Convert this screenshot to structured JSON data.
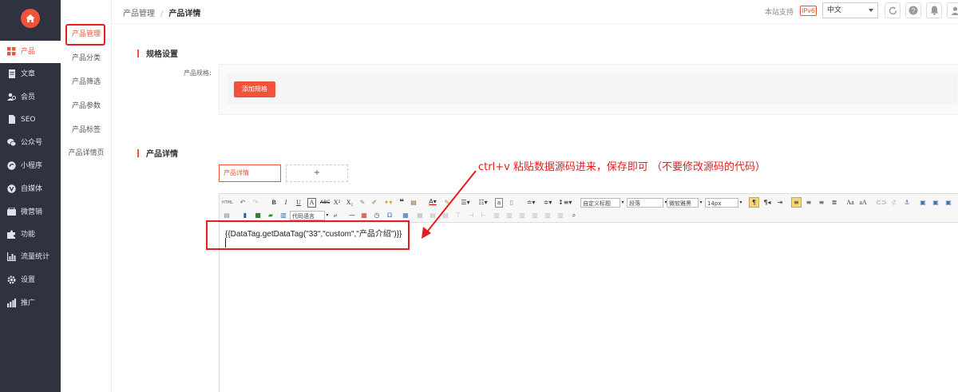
{
  "sidebar": {
    "items": [
      {
        "label": "产品",
        "icon": "grid-icon",
        "active": true
      },
      {
        "label": "文章",
        "icon": "document-icon"
      },
      {
        "label": "会员",
        "icon": "users-icon"
      },
      {
        "label": "SEO",
        "icon": "file-icon"
      },
      {
        "label": "公众号",
        "icon": "wechat-icon"
      },
      {
        "label": "小程序",
        "icon": "miniprogram-icon"
      },
      {
        "label": "自媒体",
        "icon": "media-icon"
      },
      {
        "label": "微营销",
        "icon": "marketing-icon"
      },
      {
        "label": "功能",
        "icon": "puzzle-icon"
      },
      {
        "label": "流量统计",
        "icon": "chart-icon"
      },
      {
        "label": "设置",
        "icon": "gear-icon"
      },
      {
        "label": "推广",
        "icon": "promote-icon"
      }
    ]
  },
  "subnav": {
    "items": [
      {
        "label": "产品管理",
        "active": true
      },
      {
        "label": "产品分类"
      },
      {
        "label": "产品筛选"
      },
      {
        "label": "产品参数"
      },
      {
        "label": "产品标签"
      },
      {
        "label": "产品详情页"
      }
    ]
  },
  "topbar": {
    "breadcrumb": [
      "产品管理",
      "产品详情"
    ],
    "support": "本站支持",
    "ipv6": "IPv6",
    "language": "中文"
  },
  "spec": {
    "title": "规格设置",
    "field_label": "产品规格:",
    "add_button": "添加规格"
  },
  "detail": {
    "title": "产品详情",
    "tab_active": "产品详情",
    "tab_add": "+"
  },
  "editor": {
    "content": "{{DataTag.getDataTag(\"33\",\"custom\",\"产品介绍\")}}",
    "font_style": "自定义标题",
    "paragraph": "段落",
    "font_family": "微软雅黑",
    "font_size": "14px",
    "code_language": "代码语言"
  },
  "annotation": {
    "note": "ctrl+v 粘贴数据源码进来，保存即可 （不要修改源码的代码）"
  },
  "colors": {
    "accent": "#f0533a",
    "sidebar_bg": "#2f3340",
    "highlight": "#e21e1e"
  }
}
